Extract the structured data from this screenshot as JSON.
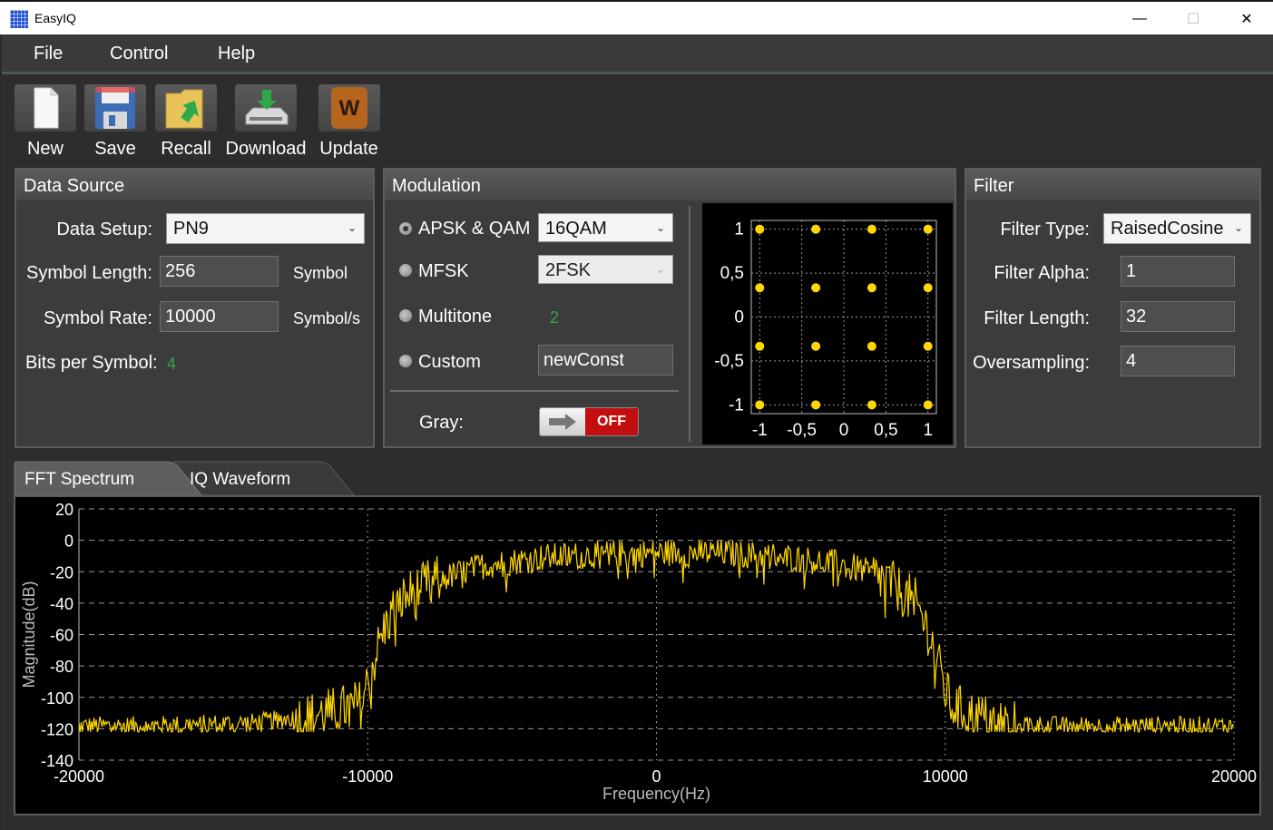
{
  "window": {
    "title": "EasyIQ",
    "minimize": "—",
    "maximize": "☐",
    "close": "✕"
  },
  "menu": [
    "File",
    "Control",
    "Help"
  ],
  "toolbar": [
    {
      "label": "New",
      "icon": "new-file-icon"
    },
    {
      "label": "Save",
      "icon": "floppy-disk-icon"
    },
    {
      "label": "Recall",
      "icon": "folder-recall-icon"
    },
    {
      "label": "Download",
      "icon": "download-drive-icon"
    },
    {
      "label": "Update",
      "icon": "update-logo-icon"
    }
  ],
  "data_source": {
    "title": "Data Source",
    "data_setup_label": "Data Setup:",
    "data_setup_value": "PN9",
    "symbol_length_label": "Symbol Length:",
    "symbol_length_value": "256",
    "symbol_length_unit": "Symbol",
    "symbol_rate_label": "Symbol Rate:",
    "symbol_rate_value": "10000",
    "symbol_rate_unit": "Symbol/s",
    "bits_per_symbol_label": "Bits per Symbol:",
    "bits_per_symbol_value": "4"
  },
  "modulation": {
    "title": "Modulation",
    "apsk_label": "APSK & QAM",
    "apsk_value": "16QAM",
    "mfsk_label": "MFSK",
    "mfsk_value": "2FSK",
    "multitone_label": "Multitone",
    "multitone_value": "2",
    "custom_label": "Custom",
    "custom_value": "newConst",
    "gray_label": "Gray:",
    "gray_toggle": "OFF",
    "selected": "APSK & QAM"
  },
  "constellation": {
    "y_ticks": [
      "1",
      "0,5",
      "0",
      "-0,5",
      "-1"
    ],
    "x_ticks": [
      "-1",
      "-0,5",
      "0",
      "0,5",
      "1"
    ],
    "point_color": "#ffd700"
  },
  "filter": {
    "title": "Filter",
    "filter_type_label": "Filter Type:",
    "filter_type_value": "RaisedCosine",
    "filter_alpha_label": "Filter Alpha:",
    "filter_alpha_value": "1",
    "filter_length_label": "Filter Length:",
    "filter_length_value": "32",
    "oversampling_label": "Oversampling:",
    "oversampling_value": "4"
  },
  "tabs": [
    {
      "label": "FFT Spectrum",
      "active": true
    },
    {
      "label": "IQ Waveform",
      "active": false
    }
  ],
  "chart_data": [
    {
      "type": "scatter",
      "x": [
        -1,
        -0.333,
        0.333,
        1,
        -1,
        -0.333,
        0.333,
        1,
        -1,
        -0.333,
        0.333,
        1,
        -1,
        -0.333,
        0.333,
        1
      ],
      "y": [
        1,
        1,
        1,
        1,
        0.333,
        0.333,
        0.333,
        0.333,
        -0.333,
        -0.333,
        -0.333,
        -0.333,
        -1,
        -1,
        -1,
        -1
      ],
      "xlim": [
        -1.1,
        1.1
      ],
      "ylim": [
        -1.1,
        1.1
      ],
      "grid": true,
      "color": "#ffd700"
    },
    {
      "type": "line",
      "xlabel": "Frequency(Hz)",
      "ylabel": "Magnitude(dB)",
      "xlim": [
        -20000,
        20000
      ],
      "ylim": [
        -140,
        20
      ],
      "x_ticks": [
        -20000,
        -10000,
        0,
        10000,
        20000
      ],
      "y_ticks": [
        20,
        0,
        -20,
        -40,
        -60,
        -80,
        -100,
        -120,
        -140
      ],
      "grid": true,
      "color": "#ffd700",
      "series": [
        {
          "x": [
            -20000,
            -18000,
            -16000,
            -14000,
            -12000,
            -11000,
            -10200,
            -10000,
            -9500,
            -9000,
            -8000,
            -7000,
            -6000,
            -4000,
            -2000,
            0,
            2000,
            4000,
            6000,
            7000,
            8000,
            9000,
            9500,
            10000,
            10200,
            11000,
            12000,
            14000,
            16000,
            18000,
            20000
          ],
          "values": [
            -118,
            -118,
            -117,
            -116,
            -112,
            -108,
            -104,
            -90,
            -60,
            -40,
            -28,
            -22,
            -16,
            -11,
            -9,
            -8,
            -8,
            -10,
            -14,
            -18,
            -26,
            -40,
            -62,
            -95,
            -105,
            -112,
            -116,
            -118,
            -118,
            -118,
            -118
          ]
        }
      ]
    }
  ]
}
